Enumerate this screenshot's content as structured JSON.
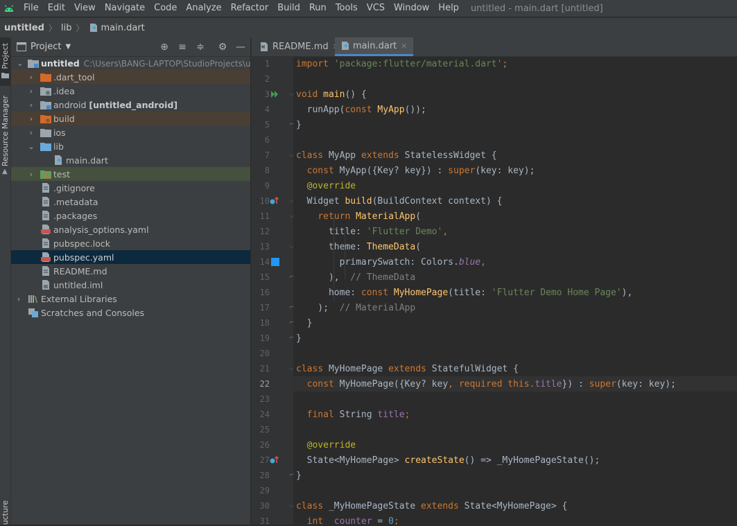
{
  "menu": {
    "items": [
      "File",
      "Edit",
      "View",
      "Navigate",
      "Code",
      "Analyze",
      "Refactor",
      "Build",
      "Run",
      "Tools",
      "VCS",
      "Window",
      "Help"
    ],
    "window_title": "untitled - main.dart [untitled]"
  },
  "nav": {
    "project": "untitled",
    "folder": "lib",
    "file": "main.dart"
  },
  "strip": {
    "project": "Project",
    "resource_manager": "Resource Manager",
    "structure": "ucture"
  },
  "project_panel": {
    "title": "Project"
  },
  "tree": {
    "root_name": "untitled",
    "root_path": "C:\\Users\\BANG-LAPTOP\\StudioProjects\\unt",
    "dart_tool": ".dart_tool",
    "idea": ".idea",
    "android": "android",
    "android_module": "[untitled_android]",
    "build": "build",
    "ios": "ios",
    "lib": "lib",
    "main_dart": "main.dart",
    "test": "test",
    "gitignore": ".gitignore",
    "metadata": ".metadata",
    "packages": ".packages",
    "analysis_options": "analysis_options.yaml",
    "pubspec_lock": "pubspec.lock",
    "pubspec_yaml": "pubspec.yaml",
    "readme": "README.md",
    "untitled_iml": "untitled.iml",
    "external_libraries": "External Libraries",
    "scratches": "Scratches and Consoles"
  },
  "tabs": {
    "readme": "README.md",
    "main": "main.dart"
  },
  "code": {
    "line_numbers": [
      "1",
      "2",
      "3",
      "4",
      "5",
      "6",
      "7",
      "8",
      "9",
      "10",
      "11",
      "12",
      "13",
      "14",
      "15",
      "16",
      "17",
      "18",
      "19",
      "20",
      "21",
      "22",
      "23",
      "24",
      "25",
      "26",
      "27",
      "28",
      "29",
      "30",
      "31"
    ],
    "l1": {
      "a": "import ",
      "b": "'package:flutter/material.dart'",
      "c": ";"
    },
    "l3": {
      "a": "void ",
      "b": "main",
      "c": "() {"
    },
    "l4": {
      "a": "  runApp(",
      "b": "const ",
      "c": "MyApp",
      "d": "());"
    },
    "l5": {
      "a": "}"
    },
    "l7": {
      "a": "class ",
      "b": "MyApp ",
      "c": "extends ",
      "d": "StatelessWidget {"
    },
    "l8": {
      "a": "  ",
      "b": "const ",
      "c": "MyApp({Key? key}) : ",
      "d": "super",
      "e": "(key: key);"
    },
    "l9": {
      "a": "  ",
      "b": "@override"
    },
    "l10": {
      "a": "  Widget ",
      "b": "build",
      "c": "(BuildContext context) {"
    },
    "l11": {
      "a": "    ",
      "b": "return ",
      "c": "MaterialApp",
      "d": "("
    },
    "l12": {
      "a": "      title: ",
      "b": "'Flutter Demo'",
      "c": ","
    },
    "l13": {
      "a": "      theme: ",
      "b": "ThemeData",
      "c": "("
    },
    "l14": {
      "a": "        primarySwatch: Colors.",
      "b": "blue",
      "c": ","
    },
    "l15": {
      "a": "      ),  ",
      "b": "// ThemeData"
    },
    "l16": {
      "a": "      home: ",
      "b": "const ",
      "c": "MyHomePage",
      "d": "(title: ",
      "e": "'Flutter Demo Home Page'",
      "f": "),"
    },
    "l17": {
      "a": "    );  ",
      "b": "// MaterialApp"
    },
    "l18": {
      "a": "  }"
    },
    "l19": {
      "a": "}"
    },
    "l21": {
      "a": "class ",
      "b": "MyHomePage ",
      "c": "extends ",
      "d": "StatefulWidget {"
    },
    "l22": {
      "a": "  ",
      "b": "const ",
      "c": "MyHomePage({Key? key",
      "d": ", required this.",
      "e": "title",
      "f": "}) : ",
      "g": "super",
      "h": "(key: key);"
    },
    "l24": {
      "a": "  ",
      "b": "final ",
      "c": "String ",
      "d": "title",
      "e": ";"
    },
    "l26": {
      "a": "  ",
      "b": "@override"
    },
    "l27": {
      "a": "  State<MyHomePage> ",
      "b": "createState",
      "c": "() => _MyHomePageState();"
    },
    "l28": {
      "a": "}"
    },
    "l30": {
      "a": "class ",
      "b": "_MyHomePageState ",
      "c": "extends ",
      "d": "State<MyHomePage> {"
    },
    "l31": {
      "a": "  int ",
      "b": "_counter",
      "c": " = ",
      "d": "0",
      "e": ";"
    }
  }
}
